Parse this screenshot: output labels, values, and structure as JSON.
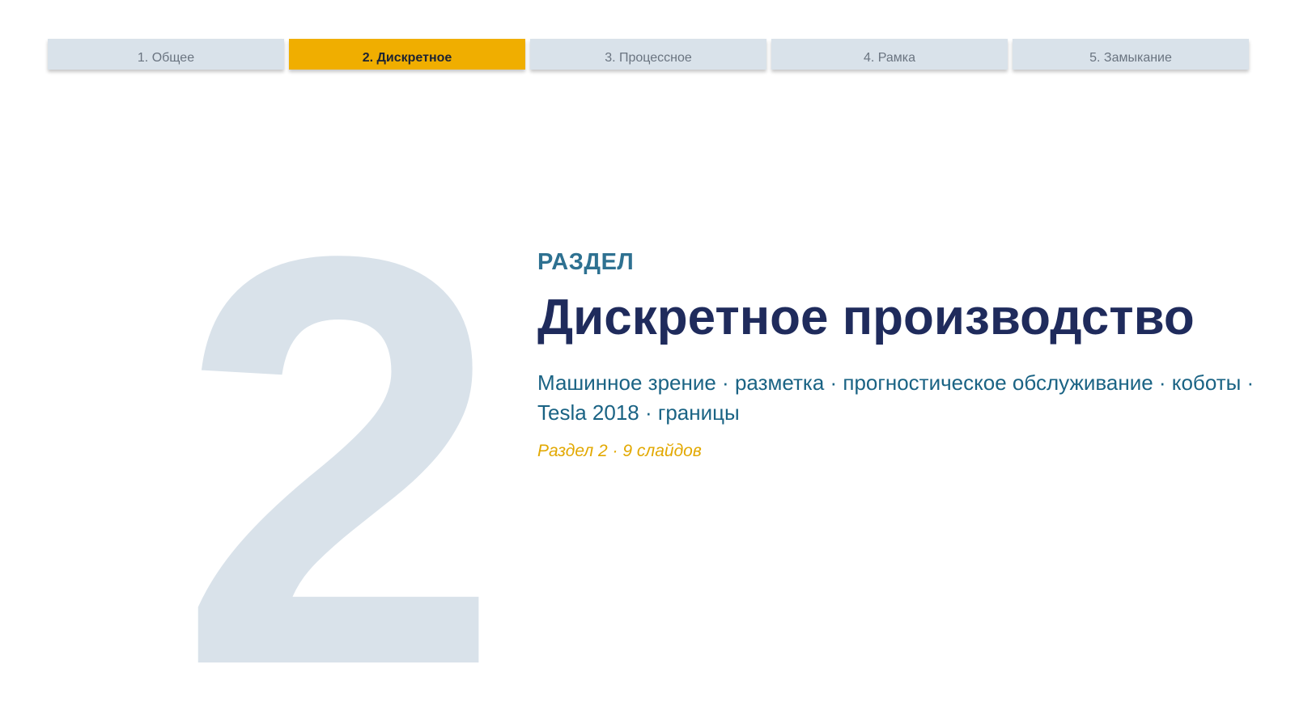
{
  "nav": {
    "tabs": [
      {
        "label": "1. Общее",
        "active": false
      },
      {
        "label": "2. Дискретное",
        "active": true
      },
      {
        "label": "3. Процессное",
        "active": false
      },
      {
        "label": "4. Рамка",
        "active": false
      },
      {
        "label": "5. Замыкание",
        "active": false
      }
    ]
  },
  "section": {
    "number": "2",
    "kicker": "РАЗДЕЛ",
    "title": "Дискретное производство",
    "subtitle": "Машинное зрение · разметка · прогностическое обслуживание · коботы · Tesla 2018 · границы",
    "meta": "Раздел 2 · 9 слайдов"
  },
  "colors": {
    "active_tab": "#f0ae00",
    "inactive_tab": "#d9e2ea",
    "title": "#1f2b5c",
    "kicker": "#2e7191",
    "subtitle": "#1a6384",
    "meta": "#e2a800",
    "big_number": "#d9e2ea"
  }
}
